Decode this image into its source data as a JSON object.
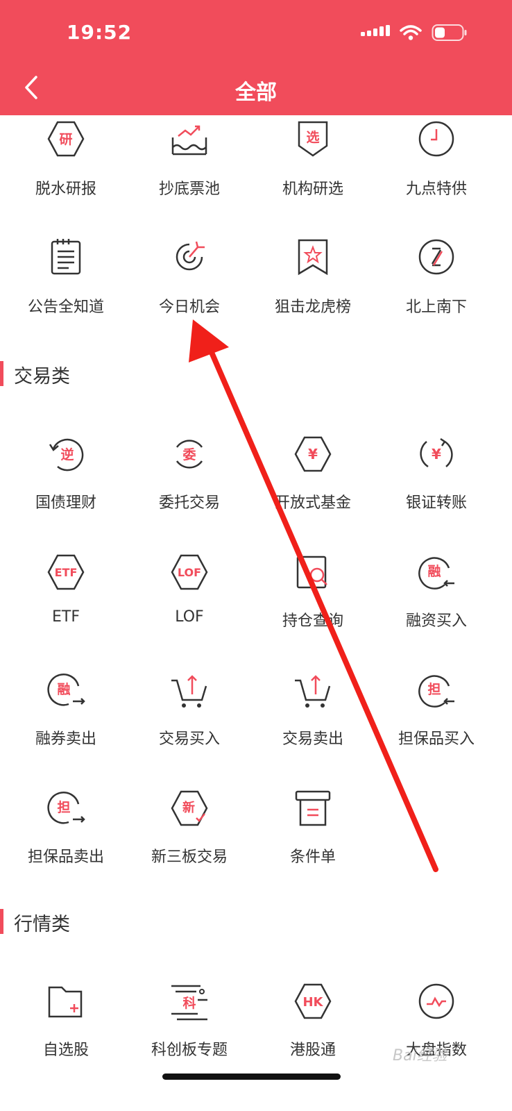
{
  "status": {
    "time": "19:52"
  },
  "header": {
    "title": "全部"
  },
  "top_rows": [
    {
      "label": "脱水研报",
      "icon": "yan-hexagon-icon",
      "glyph": "研"
    },
    {
      "label": "抄底票池",
      "icon": "rising-chart-pool-icon"
    },
    {
      "label": "机构研选",
      "icon": "xuan-shield-icon",
      "glyph": "选"
    },
    {
      "label": "九点特供",
      "icon": "clock-icon"
    },
    {
      "label": "公告全知道",
      "icon": "document-list-icon"
    },
    {
      "label": "今日机会",
      "icon": "opportunity-target-icon"
    },
    {
      "label": "狙击龙虎榜",
      "icon": "star-bookmark-icon"
    },
    {
      "label": "北上南下",
      "icon": "north-south-circle-icon"
    }
  ],
  "sections": [
    {
      "title": "交易类",
      "items": [
        {
          "label": "国债理财",
          "icon": "reverse-repo-icon",
          "glyph": "逆"
        },
        {
          "label": "委托交易",
          "icon": "entrust-icon",
          "glyph": "委"
        },
        {
          "label": "开放式基金",
          "icon": "yen-hexagon-icon",
          "glyph": "¥"
        },
        {
          "label": "银证转账",
          "icon": "yen-transfer-icon",
          "glyph": "¥"
        },
        {
          "label": "ETF",
          "icon": "etf-hexagon-icon",
          "glyph": "ETF"
        },
        {
          "label": "LOF",
          "icon": "lof-hexagon-icon",
          "glyph": "LOF"
        },
        {
          "label": "持仓查询",
          "icon": "position-search-icon"
        },
        {
          "label": "融资买入",
          "icon": "margin-buy-icon",
          "glyph": "融"
        },
        {
          "label": "融券卖出",
          "icon": "short-sell-icon",
          "glyph": "融"
        },
        {
          "label": "交易买入",
          "icon": "cart-buy-icon"
        },
        {
          "label": "交易卖出",
          "icon": "cart-sell-icon"
        },
        {
          "label": "担保品买入",
          "icon": "collateral-buy-icon",
          "glyph": "担"
        },
        {
          "label": "担保品卖出",
          "icon": "collateral-sell-icon",
          "glyph": "担"
        },
        {
          "label": "新三板交易",
          "icon": "new-third-board-icon",
          "glyph": "新"
        },
        {
          "label": "条件单",
          "icon": "conditional-order-icon"
        }
      ]
    },
    {
      "title": "行情类",
      "items": [
        {
          "label": "自选股",
          "icon": "add-folder-icon"
        },
        {
          "label": "科创板专题",
          "icon": "star-market-icon",
          "glyph": "科"
        },
        {
          "label": "港股通",
          "icon": "hk-hexagon-icon",
          "glyph": "HK"
        },
        {
          "label": "大盘指数",
          "icon": "index-pulse-icon"
        }
      ]
    }
  ],
  "watermark": "Bai经验",
  "colors": {
    "brand": "#f14c5b",
    "icon_dark": "#333333",
    "icon_accent": "#f14c5b",
    "arrow": "#f0201a"
  }
}
